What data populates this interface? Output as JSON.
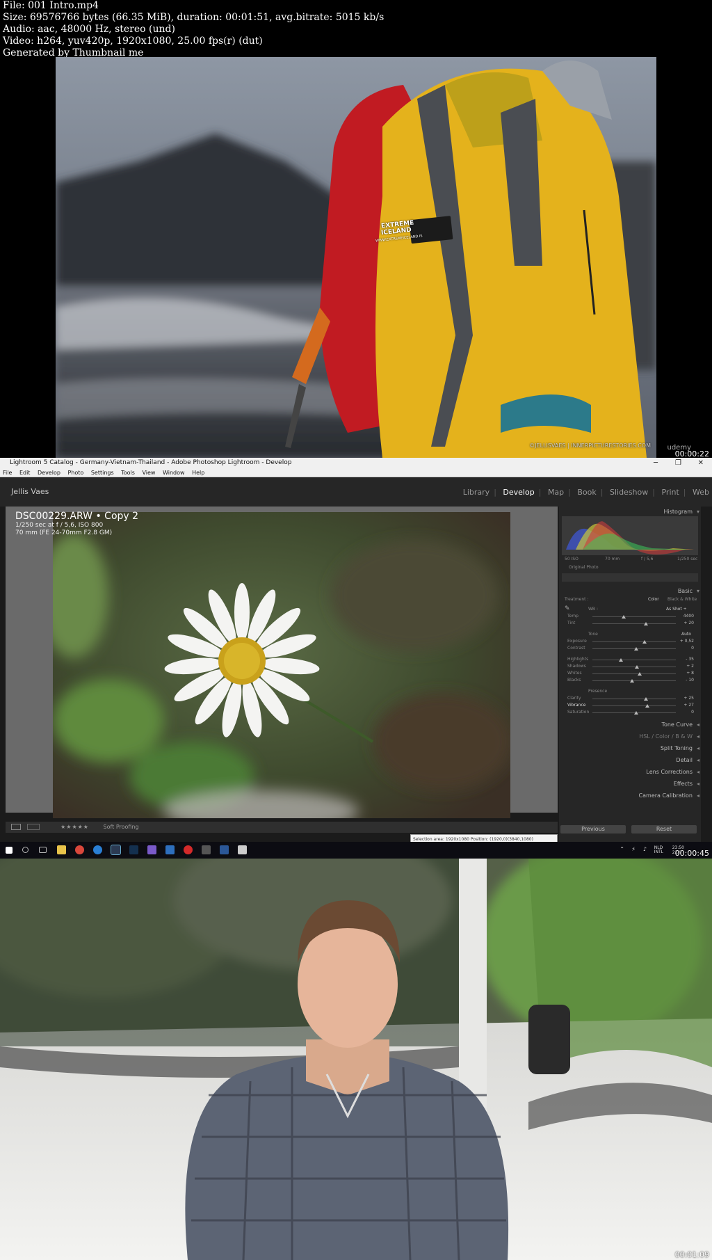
{
  "file_info": {
    "line1": "File: 001 Intro.mp4",
    "line2": "Size: 69576766 bytes (66.35 MiB), duration: 00:01:51, avg.bitrate: 5015 kb/s",
    "line3": "Audio: aac, 48000 Hz, stereo (und)",
    "line4": "Video: h264, yuv420p, 1920x1080, 25.00 fps(r) (dut)",
    "line5": "Generated by Thumbnail me"
  },
  "frame1": {
    "timestamp": "00:00:22",
    "patch_line1": "EXTREME",
    "patch_line2": "ICELAND",
    "patch_url": "WWW.EXTREMEICELAND.IS",
    "watermark": "udemy",
    "credit": "©JELLISVAES | INNERPICTURESTORIES.COM"
  },
  "frame2": {
    "timestamp": "00:00:45",
    "window_title": "Lightroom 5 Catalog - Germany-Vietnam-Thailand - Adobe Photoshop Lightroom - Develop",
    "menu": [
      "File",
      "Edit",
      "Develop",
      "Photo",
      "Settings",
      "Tools",
      "View",
      "Window",
      "Help"
    ],
    "identity_plate": "Jellis Vaes",
    "modules": [
      "Library",
      "Develop",
      "Map",
      "Book",
      "Slideshow",
      "Print",
      "Web"
    ],
    "active_module": "Develop",
    "photo": {
      "filename": "DSC00229.ARW • Copy 2",
      "exposure_info": "1/250 sec at f / 5,6, ISO 800",
      "lens_info": "70 mm (FE 24-70mm F2.8 GM)"
    },
    "panels": {
      "histogram": "Histogram",
      "histo_readouts": [
        "50 ISO",
        "70 mm",
        "f / 5,6",
        "1/250 sec"
      ],
      "original_photo": "Original Photo",
      "basic": "Basic",
      "treatment": "Treatment :",
      "color": "Color",
      "bw": "Black & White",
      "wb": "WB :",
      "as_shot": "As Shot ÷",
      "tone": "Tone",
      "auto": "Auto",
      "presence": "Presence",
      "tone_curve": "Tone Curve",
      "hsl": "HSL / Color / B & W",
      "split_toning": "Split Toning",
      "detail": "Detail",
      "lens_corrections": "Lens Corrections",
      "effects": "Effects",
      "camera_calibration": "Camera Calibration",
      "previous_button": "Previous",
      "reset_button": "Reset"
    },
    "sliders": [
      {
        "label": "Temp",
        "value": "4400",
        "pos": 0.35
      },
      {
        "label": "Tint",
        "value": "+ 20",
        "pos": 0.62
      },
      {
        "label": "Exposure",
        "value": "+ 0,52",
        "pos": 0.6
      },
      {
        "label": "Contrast",
        "value": "0",
        "pos": 0.5
      },
      {
        "label": "Highlights",
        "value": "- 35",
        "pos": 0.32
      },
      {
        "label": "Shadows",
        "value": "+ 2",
        "pos": 0.51
      },
      {
        "label": "Whites",
        "value": "+ 8",
        "pos": 0.54
      },
      {
        "label": "Blacks",
        "value": "- 10",
        "pos": 0.45
      },
      {
        "label": "Clarity",
        "value": "+ 25",
        "pos": 0.62
      },
      {
        "label": "Vibrance",
        "value": "+ 27",
        "pos": 0.63
      },
      {
        "label": "Saturation",
        "value": "0",
        "pos": 0.5
      }
    ],
    "toolbar": {
      "stars": "★★★★★",
      "soft_proofing": "Soft Proofing"
    },
    "tooltip": "Selection area: 1920x1080 Position: (1920,0)(3840,1080)",
    "tray": {
      "lang1": "NLD",
      "lang2": "INTL",
      "time": "23:50",
      "date": "21/0"
    }
  },
  "frame3": {
    "timestamp": "00:01:09"
  }
}
